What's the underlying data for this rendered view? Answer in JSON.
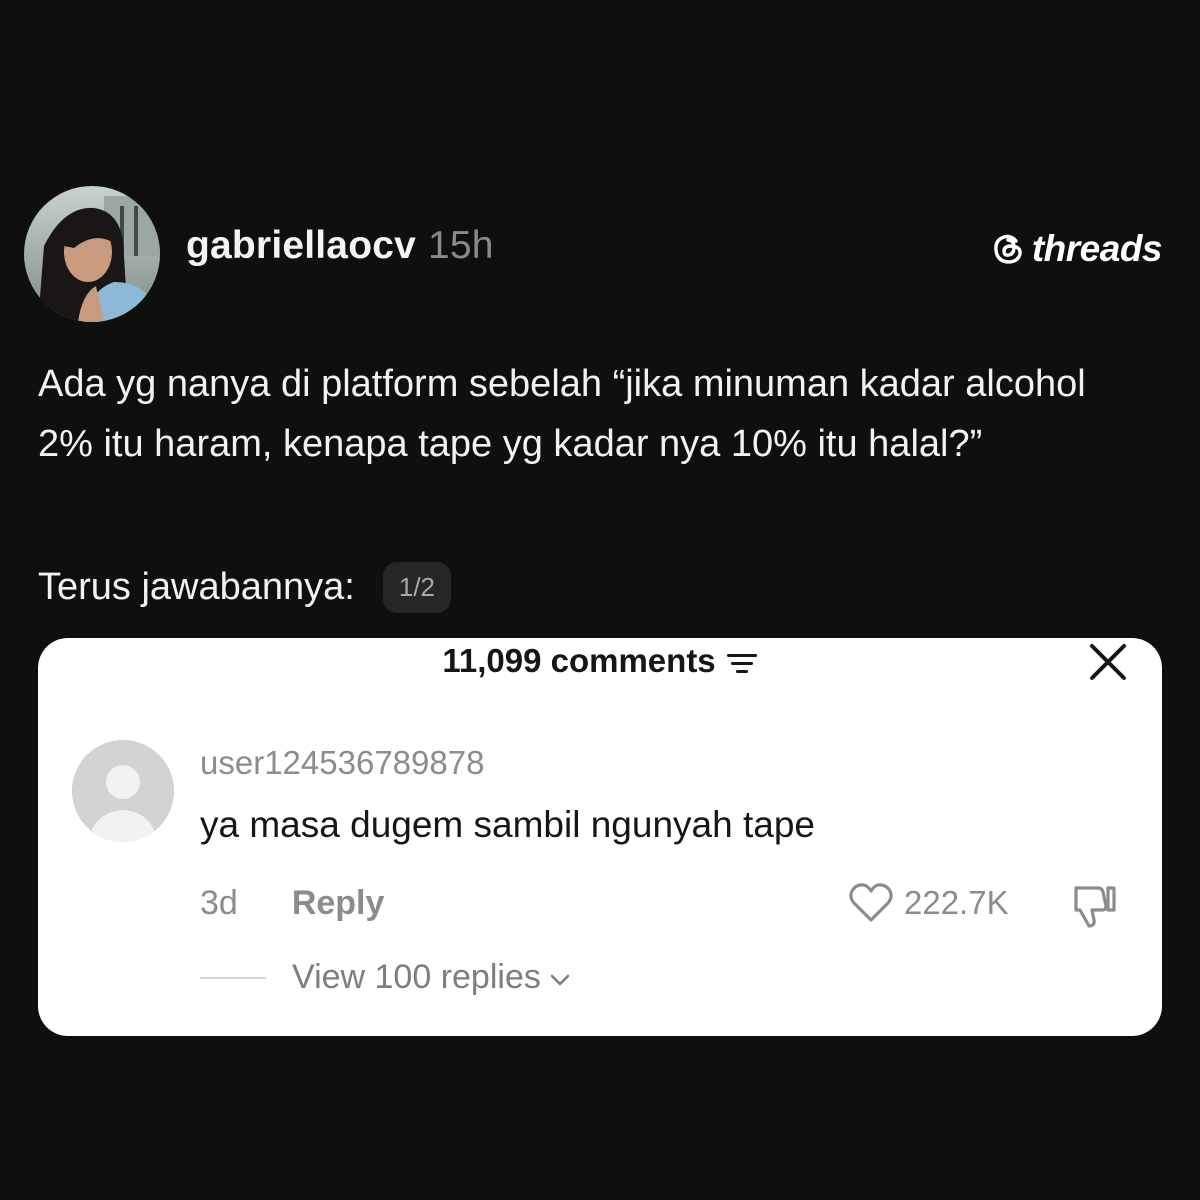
{
  "post": {
    "username": "gabriellaocv",
    "time_ago": "15h",
    "brand": "threads",
    "text": "Ada yg nanya di platform sebelah “jika minuman kadar alcohol 2% itu haram, kenapa tape yg kadar nya 10% itu halal?”",
    "text2": "Terus jawabannya:",
    "page_indicator": "1/2",
    "avatar_icon": "profile-photo",
    "brand_icon": "threads-logo"
  },
  "comments_panel": {
    "count_label": "11,099 comments",
    "filter_icon": "filter-icon",
    "close_icon": "close-icon",
    "comment": {
      "user": "user124536789878",
      "text": "ya masa dugem sambil ngunyah tape",
      "age": "3d",
      "reply_label": "Reply",
      "likes": "222.7K",
      "view_replies": "View 100 replies"
    }
  },
  "colors": {
    "background": "#0f0f0f",
    "card": "#ffffff",
    "muted_text": "#8c8c8c",
    "pill": "#262626"
  }
}
